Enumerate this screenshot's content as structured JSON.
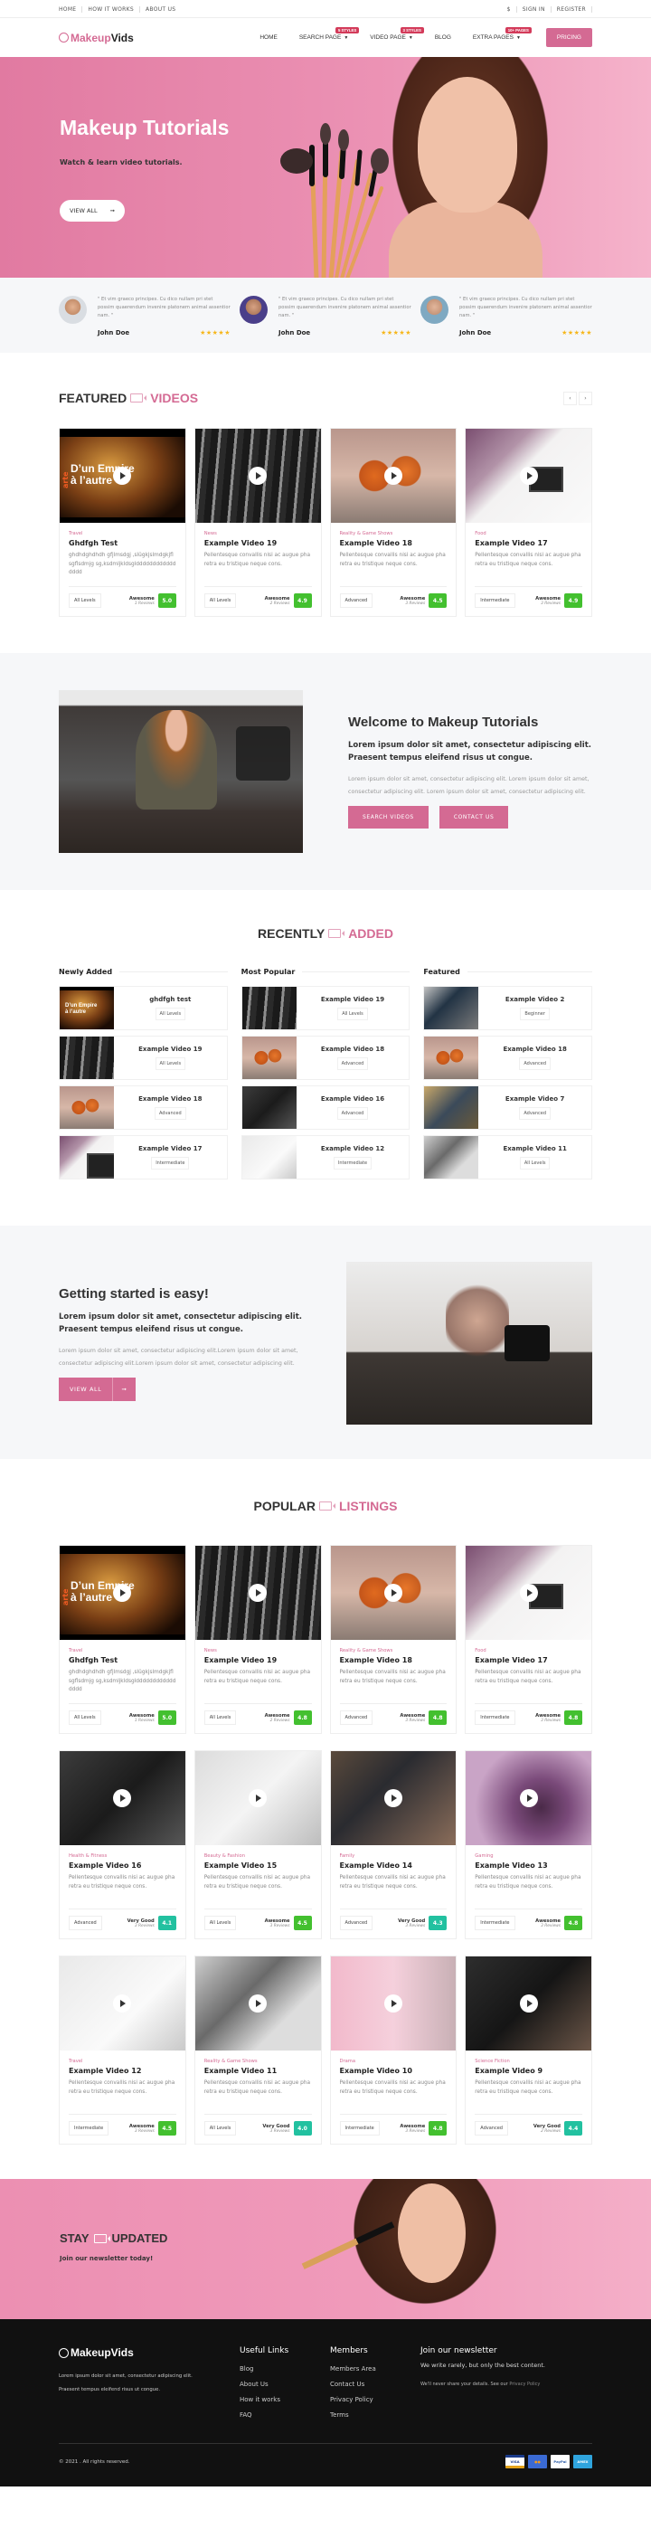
{
  "topbar": {
    "left_links": [
      "HOME",
      "HOW IT WORKS",
      "ABOUT US"
    ],
    "currency": "$",
    "sign_in": "SIGN IN",
    "register": "REGISTER"
  },
  "nav": {
    "logo_part1": "Makeup",
    "logo_part2": "Vids",
    "items": [
      {
        "label": "HOME",
        "badge": "",
        "dropdown": false
      },
      {
        "label": "SEARCH PAGE",
        "badge": "5 STYLES",
        "dropdown": true
      },
      {
        "label": "VIDEO PAGE",
        "badge": "3 STYLES",
        "dropdown": true
      },
      {
        "label": "BLOG",
        "badge": "",
        "dropdown": false
      },
      {
        "label": "EXTRA PAGES",
        "badge": "10+ PAGES",
        "dropdown": true
      }
    ],
    "pricing": "PRICING"
  },
  "hero": {
    "title": "Makeup Tutorials",
    "subtitle": "Watch & learn video tutorials.",
    "button": "VIEW ALL",
    "button_icon": "arrow-right-icon"
  },
  "testimonials": [
    {
      "quote": "\" Et vim graeco principes. Cu dico nullam pri stet possim quaerendum invenire platonem animal assentior nam. \"",
      "name": "John Doe",
      "stars": 5
    },
    {
      "quote": "\" Et vim graeco principes. Cu dico nullam pri stet possim quaerendum invenire platonem animal assentior nam. \"",
      "name": "John Doe",
      "stars": 5
    },
    {
      "quote": "\" Et vim graeco principes. Cu dico nullam pri stet possim quaerendum invenire platonem animal assentior nam. \"",
      "name": "John Doe",
      "stars": 5
    }
  ],
  "featured": {
    "title_dark": "FEATURED",
    "title_pink": "VIDEOS",
    "prev": "‹",
    "next": "›",
    "cards": [
      {
        "category": "Travel",
        "title": "Ghdfgh Test",
        "desc": "ghdhdghdhdh gfjlmsdgj ,slügkjslmdgkjflsgflsdmjg sg,ksdmljkldsgldddddddddddddddd",
        "level": "All Levels",
        "rating_label": "Awesome",
        "reviews": "1 Reviews",
        "score": "5.0",
        "score_color": "green",
        "thumb": "arte"
      },
      {
        "category": "News",
        "title": "Example Video 19",
        "desc": "Pellentesque convallis nisi ac augue pharetra eu tristique neque cons.",
        "level": "All Levels",
        "rating_label": "Awesome",
        "reviews": "2 Reviews",
        "score": "4.9",
        "score_color": "green",
        "thumb": "brushbw"
      },
      {
        "category": "Reality & Game Shows",
        "title": "Example Video 18",
        "desc": "Pellentesque convallis nisi ac augue pharetra eu tristique neque cons.",
        "level": "Advanced",
        "rating_label": "Awesome",
        "reviews": "3 Reviews",
        "score": "4.5",
        "score_color": "green",
        "thumb": "orange"
      },
      {
        "category": "Food",
        "title": "Example Video 17",
        "desc": "Pellentesque convallis nisi ac augue pharetra eu tristique neque cons.",
        "level": "Intermediate",
        "rating_label": "Awesome",
        "reviews": "3 Reviews",
        "score": "4.9",
        "score_color": "green",
        "thumb": "palette"
      }
    ]
  },
  "welcome": {
    "title": "Welcome to Makeup Tutorials",
    "lead": "Lorem ipsum dolor sit amet, consectetur adipiscing elit. Praesent tempus eleifend risus ut congue.",
    "body": "Lorem ipsum dolor sit amet, consectetur adipiscing elit. Lorem ipsum dolor sit amet, consectetur adipiscing elit. Lorem ipsum dolor sit amet, consectetur adipiscing elit.",
    "button1": "SEARCH VIDEOS",
    "button2": "CONTACT US"
  },
  "recent": {
    "title_dark": "RECENTLY",
    "title_pink": "ADDED",
    "columns": [
      {
        "heading": "Newly Added",
        "items": [
          {
            "title": "ghdfgh test",
            "level": "All Levels",
            "thumb": "arte"
          },
          {
            "title": "Example Video 19",
            "level": "All Levels",
            "thumb": "brushbw"
          },
          {
            "title": "Example Video 18",
            "level": "Advanced",
            "thumb": "orange"
          },
          {
            "title": "Example Video 17",
            "level": "Intermediate",
            "thumb": "palette"
          }
        ]
      },
      {
        "heading": "Most Popular",
        "items": [
          {
            "title": "Example Video 19",
            "level": "All Levels",
            "thumb": "brushbw"
          },
          {
            "title": "Example Video 18",
            "level": "Advanced",
            "thumb": "orange"
          },
          {
            "title": "Example Video 16",
            "level": "Advanced",
            "thumb": "dark"
          },
          {
            "title": "Example Video 12",
            "level": "Intermediate",
            "thumb": "flat"
          }
        ]
      },
      {
        "heading": "Featured",
        "items": [
          {
            "title": "Example Video 2",
            "level": "Beginner",
            "thumb": "kit"
          },
          {
            "title": "Example Video 18",
            "level": "Advanced",
            "thumb": "orange"
          },
          {
            "title": "Example Video 7",
            "level": "Advanced",
            "thumb": "cup"
          },
          {
            "title": "Example Video 11",
            "level": "All Levels",
            "thumb": "tools"
          }
        ]
      }
    ]
  },
  "started": {
    "title": "Getting started is easy!",
    "lead": "Lorem ipsum dolor sit amet, consectetur adipiscing elit. Praesent tempus eleifend risus ut congue.",
    "body": "Lorem ipsum dolor sit amet, consectetur adipiscing elit.Lorem ipsum dolor sit amet, consectetur adipiscing elit.Lorem ipsum dolor sit amet, consectetur adipiscing elit.",
    "button": "VIEW ALL",
    "button_icon": "arrow-right-icon"
  },
  "popular": {
    "title_dark": "POPULAR",
    "title_pink": "LISTINGS",
    "cards": [
      {
        "category": "Travel",
        "title": "Ghdfgh Test",
        "desc": "ghdhdghdhdh gfjlmsdgj ,slügkjslmdgkjflsgflsdmjg sg,ksdmljkldsgldddddddddddddddd",
        "level": "All Levels",
        "rating_label": "Awesome",
        "reviews": "1 Reviews",
        "score": "5.0",
        "score_color": "green",
        "thumb": "arte"
      },
      {
        "category": "News",
        "title": "Example Video 19",
        "desc": "Pellentesque convallis nisi ac augue pharetra eu tristique neque cons.",
        "level": "All Levels",
        "rating_label": "Awesome",
        "reviews": "2 Reviews",
        "score": "4.8",
        "score_color": "green",
        "thumb": "brushbw"
      },
      {
        "category": "Reality & Game Shows",
        "title": "Example Video 18",
        "desc": "Pellentesque convallis nisi ac augue pharetra eu tristique neque cons.",
        "level": "Advanced",
        "rating_label": "Awesome",
        "reviews": "3 Reviews",
        "score": "4.8",
        "score_color": "green",
        "thumb": "orange"
      },
      {
        "category": "Food",
        "title": "Example Video 17",
        "desc": "Pellentesque convallis nisi ac augue pharetra eu tristique neque cons.",
        "level": "Intermediate",
        "rating_label": "Awesome",
        "reviews": "3 Reviews",
        "score": "4.8",
        "score_color": "green",
        "thumb": "palette"
      },
      {
        "category": "Health & Fitness",
        "title": "Example Video 16",
        "desc": "Pellentesque convallis nisi ac augue pharetra eu tristique neque cons.",
        "level": "Advanced",
        "rating_label": "Very Good",
        "reviews": "3 Reviews",
        "score": "4.1",
        "score_color": "teal",
        "thumb": "dark"
      },
      {
        "category": "Beauty & Fashion",
        "title": "Example Video 15",
        "desc": "Pellentesque convallis nisi ac augue pharetra eu tristique neque cons.",
        "level": "All Levels",
        "rating_label": "Awesome",
        "reviews": "3 Reviews",
        "score": "4.5",
        "score_color": "green",
        "thumb": "light"
      },
      {
        "category": "Family",
        "title": "Example Video 14",
        "desc": "Pellentesque convallis nisi ac augue pharetra eu tristique neque cons.",
        "level": "Advanced",
        "rating_label": "Very Good",
        "reviews": "3 Reviews",
        "score": "4.3",
        "score_color": "teal",
        "thumb": "glasses"
      },
      {
        "category": "Gaming",
        "title": "Example Video 13",
        "desc": "Pellentesque convallis nisi ac augue pharetra eu tristique neque cons.",
        "level": "Intermediate",
        "rating_label": "Awesome",
        "reviews": "3 Reviews",
        "score": "4.8",
        "score_color": "green",
        "thumb": "purple"
      },
      {
        "category": "Travel",
        "title": "Example Video 12",
        "desc": "Pellentesque convallis nisi ac augue pharetra eu tristique neque cons.",
        "level": "Intermediate",
        "rating_label": "Awesome",
        "reviews": "3 Reviews",
        "score": "4.5",
        "score_color": "green",
        "thumb": "flat"
      },
      {
        "category": "Reality & Game Shows",
        "title": "Example Video 11",
        "desc": "Pellentesque convallis nisi ac augue pharetra eu tristique neque cons.",
        "level": "All Levels",
        "rating_label": "Very Good",
        "reviews": "3 Reviews",
        "score": "4.0",
        "score_color": "teal",
        "thumb": "tools"
      },
      {
        "category": "Drama",
        "title": "Example Video 10",
        "desc": "Pellentesque convallis nisi ac augue pharetra eu tristique neque cons.",
        "level": "Intermediate",
        "rating_label": "Awesome",
        "reviews": "3 Reviews",
        "score": "4.8",
        "score_color": "green",
        "thumb": "pink"
      },
      {
        "category": "Science Fiction",
        "title": "Example Video 9",
        "desc": "Pellentesque convallis nisi ac augue pharetra eu tristique neque cons.",
        "level": "Advanced",
        "rating_label": "Very Good",
        "reviews": "2 Reviews",
        "score": "4.4",
        "score_color": "teal",
        "thumb": "black"
      }
    ]
  },
  "newsletter_banner": {
    "title_left": "STAY",
    "title_right": "UPDATED",
    "subtitle": "Join our newsletter today!"
  },
  "footer": {
    "logo": "MakeupVids",
    "desc_line1": "Lorem ipsum dolor sit amet, consectetur adipiscing elit.",
    "desc_line2": "Praesent tempus eleifend risus ut congue.",
    "useful_links": {
      "heading": "Useful Links",
      "items": [
        "Blog",
        "About Us",
        "How it works",
        "FAQ"
      ]
    },
    "members": {
      "heading": "Members",
      "items": [
        "Members Area",
        "Contact Us",
        "Privacy Policy",
        "Terms"
      ]
    },
    "newsletter": {
      "heading": "Join our newsletter",
      "sub": "We write rarely, but only the best content.",
      "note": "We'll never share your details. See our",
      "note_link": "Privacy Policy"
    },
    "copyright": "© 2021 . All rights reserved.",
    "payments": [
      {
        "name": "visa",
        "label": "VISA"
      },
      {
        "name": "mastercard",
        "label": "●●"
      },
      {
        "name": "paypal",
        "label": "PayPal"
      },
      {
        "name": "amex",
        "label": "AMEX"
      }
    ]
  },
  "colors": {
    "accent": "#d46a93",
    "score_green": "#43c02f",
    "score_teal": "#22c1a0",
    "star": "#f6b619",
    "footer_bg": "#111111"
  }
}
